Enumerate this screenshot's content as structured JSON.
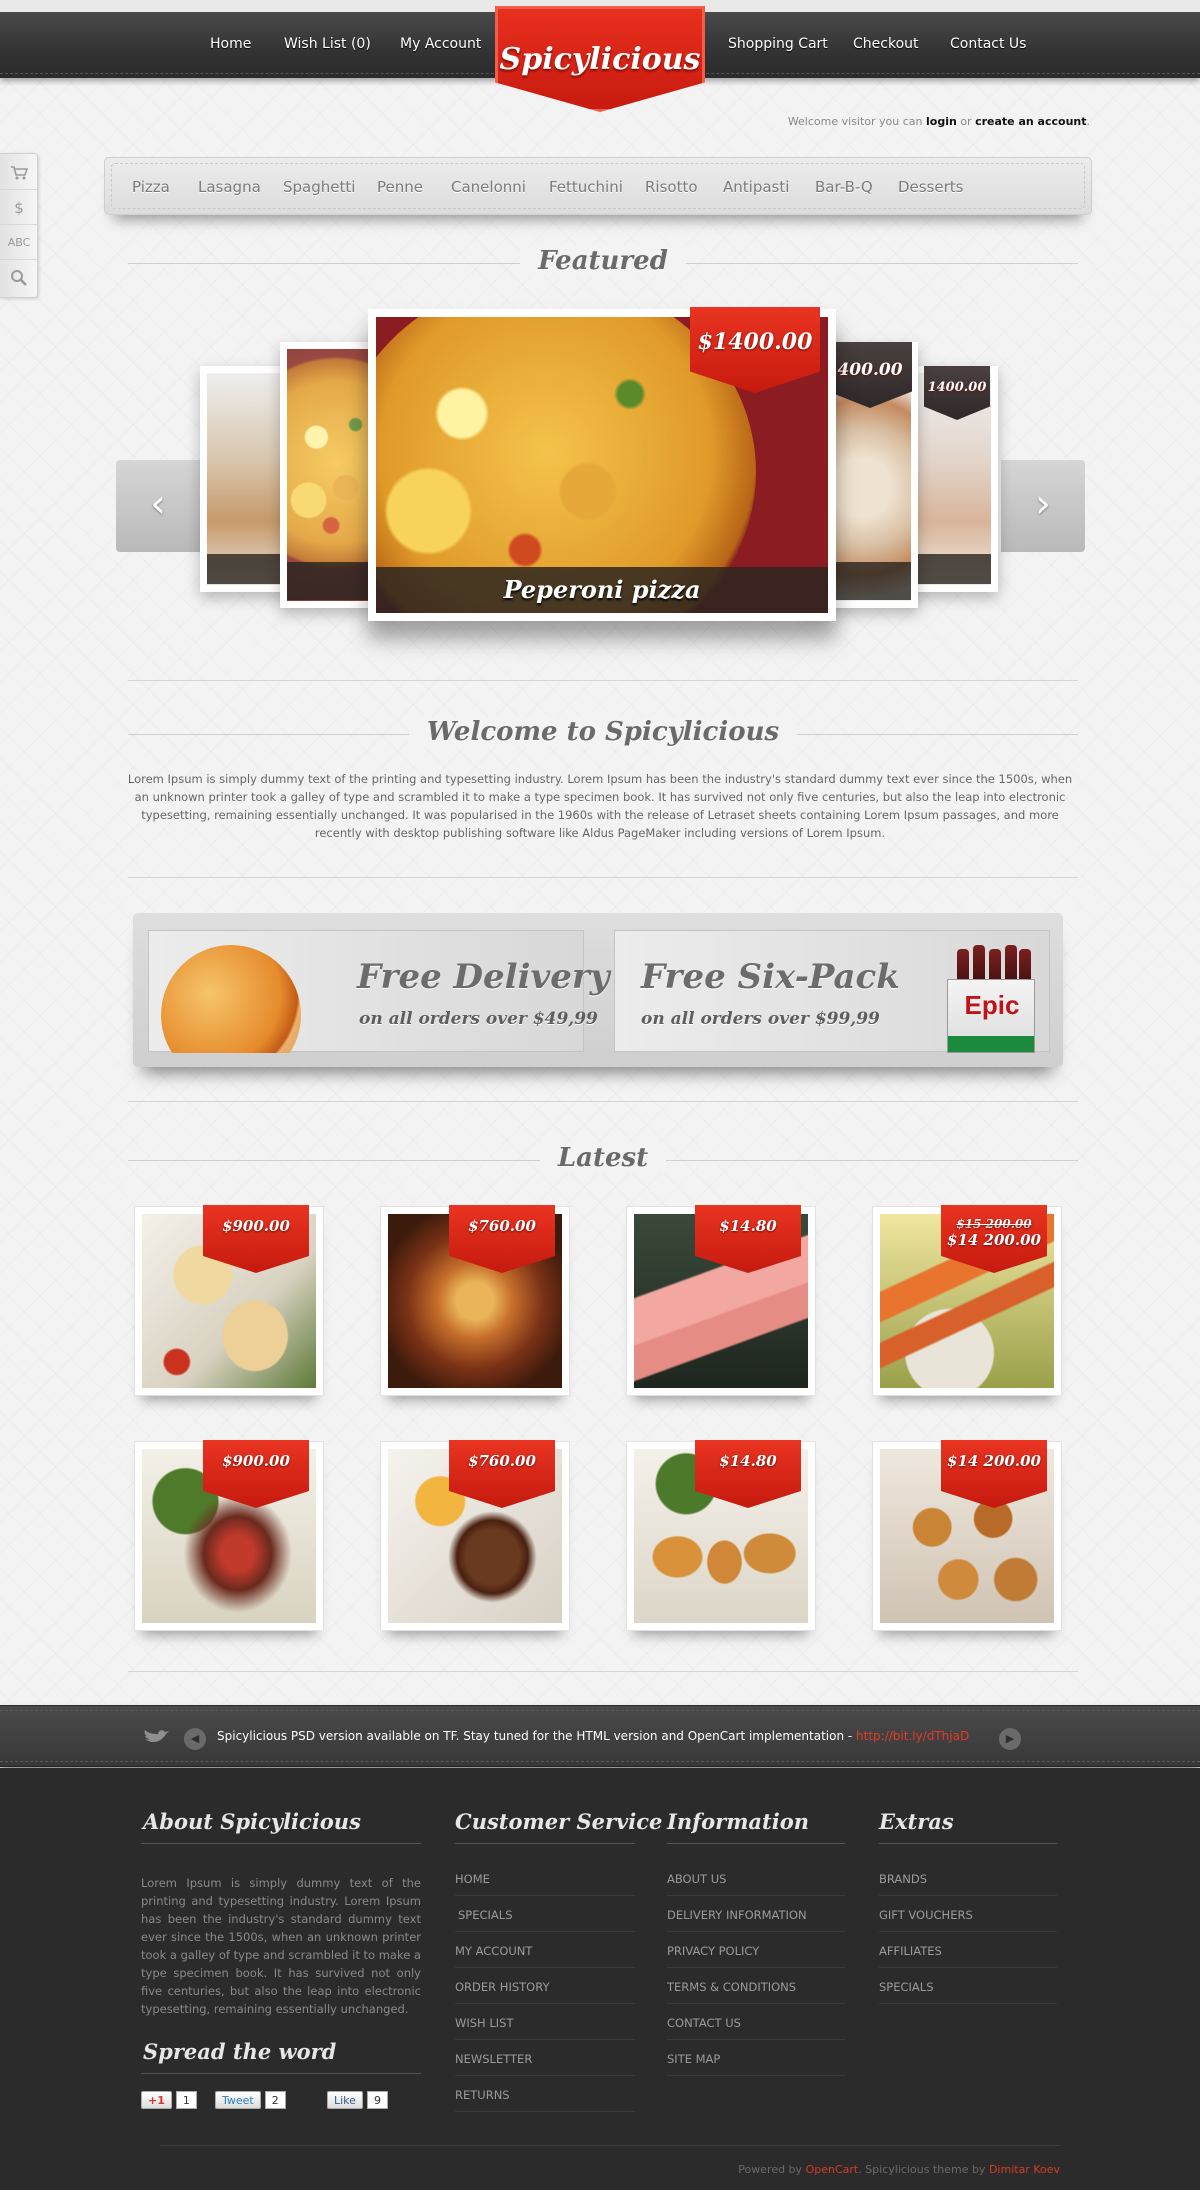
{
  "topnav": {
    "left": [
      "Home",
      "Wish List (0)",
      "My Account"
    ],
    "right": [
      "Shopping Cart",
      "Checkout",
      "Contact Us"
    ]
  },
  "logo": {
    "text": "Spicylicious"
  },
  "welcome_bar": {
    "prefix": "Welcome visitor you can",
    "login": "login",
    "or": "or",
    "create": "create an account",
    "suffix": "."
  },
  "side_tools": [
    "cart-icon",
    "dollar-icon",
    "abc-icon",
    "search-icon"
  ],
  "side_tools_glyphs": {
    "dollar": "$",
    "abc": "ABC"
  },
  "categories": [
    "Pizza",
    "Lasagna",
    "Spaghetti",
    "Penne",
    "Canelonni",
    "Fettuchini",
    "Risotto",
    "Antipasti",
    "Bar-B-Q",
    "Desserts"
  ],
  "featured": {
    "title": "Featured",
    "main": {
      "name": "Peperoni pizza",
      "price": "$1400.00"
    },
    "right_1_price": "400.00",
    "right_2_price": "1400.00",
    "prev_glyph": "‹",
    "next_glyph": "›"
  },
  "welcome": {
    "title": "Welcome to Spicylicious",
    "text": "Lorem Ipsum is simply dummy text of the printing and typesetting industry. Lorem Ipsum has been the industry's standard dummy text ever since the 1500s, when an unknown printer took a galley of type and scrambled it to make a type specimen book. It has survived not only five centuries, but also the leap into electronic typesetting, remaining essentially unchanged. It was popularised in the 1960s with the release of Letraset sheets containing Lorem Ipsum passages, and more recently with desktop publishing software like Aldus PageMaker including versions of Lorem Ipsum."
  },
  "promos": [
    {
      "title": "Free Delivery",
      "subtitle": "on all orders over $49,99"
    },
    {
      "title": "Free Six-Pack",
      "subtitle": "on all orders over $99,99",
      "brand": "Epic"
    }
  ],
  "latest": {
    "title": "Latest",
    "products": [
      {
        "price": "$900.00",
        "old_price": ""
      },
      {
        "price": "$760.00",
        "old_price": ""
      },
      {
        "price": "$14.80",
        "old_price": ""
      },
      {
        "price": "$14 200.00",
        "old_price": "$15 200.00"
      },
      {
        "price": "$900.00",
        "old_price": ""
      },
      {
        "price": "$760.00",
        "old_price": ""
      },
      {
        "price": "$14.80",
        "old_price": ""
      },
      {
        "price": "$14 200.00",
        "old_price": ""
      }
    ]
  },
  "twitter": {
    "text": "Spicylicious PSD version available on TF. Stay tuned for the HTML version and OpenCart implementation - ",
    "link": "http://bit.ly/dThjaD",
    "prev_glyph": "◀",
    "next_glyph": "▶"
  },
  "footer": {
    "about": {
      "title": "About Spicylicious",
      "text": "Lorem Ipsum is simply dummy text of the printing and typesetting industry. Lorem Ipsum has been the industry's standard dummy text ever since the 1500s, when an unknown printer took a galley of type and scrambled it to make a type specimen book. It has survived not only five centuries, but also the leap into electronic typesetting, remaining essentially unchanged."
    },
    "spread": {
      "title": "Spread the word",
      "gplus": "+1",
      "gplus_count": "1",
      "tweet": "Tweet",
      "tweet_count": "2",
      "like": "Like",
      "like_count": "9"
    },
    "customer_service": {
      "title": "Customer Service",
      "links": [
        "HOME",
        "SPECIALS",
        "MY ACCOUNT",
        "ORDER HISTORY",
        "WISH LIST",
        "NEWSLETTER",
        "RETURNS"
      ]
    },
    "information": {
      "title": "Information",
      "links": [
        "ABOUT US",
        "DELIVERY INFORMATION",
        "PRIVACY POLICY",
        "TERMS & CONDITIONS",
        "CONTACT US",
        "SITE MAP"
      ]
    },
    "extras": {
      "title": "Extras",
      "links": [
        "BRANDS",
        "GIFT VOUCHERS",
        "AFFILIATES",
        "SPECIALS"
      ]
    },
    "powered": {
      "prefix": "Powered by",
      "opencart": "OpenCart",
      "middle": ". Spicylicious theme by",
      "author": "Dimitar Koev"
    }
  },
  "colors": {
    "accent": "#d62415",
    "dark": "#333333",
    "footer": "#2b2b2b"
  }
}
